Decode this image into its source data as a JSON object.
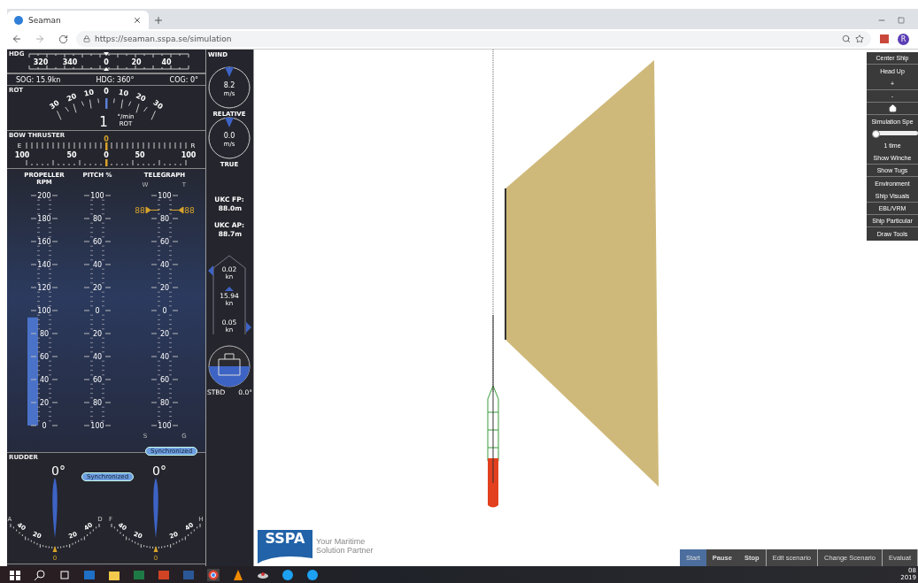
{
  "browser": {
    "tab_title": "Seaman",
    "url": "https://seaman.sspa.se/simulation",
    "avatar": "R"
  },
  "hdg": {
    "label": "HDG",
    "ticks": [
      "320",
      "340",
      "0",
      "20",
      "40"
    ],
    "readouts": [
      "SOG: 15.9kn",
      "HDG: 360°",
      "COG: 0°"
    ]
  },
  "rot": {
    "label": "ROT",
    "ticks": [
      "30",
      "20",
      "10",
      "0",
      "10",
      "20",
      "30"
    ],
    "value": "1",
    "unit": "°/min",
    "unit_caption": "ROT"
  },
  "bow_thruster": {
    "label": "BOW THRUSTER",
    "left": "E",
    "right": "R",
    "ticks": [
      "100",
      "50",
      "0",
      "50",
      "100"
    ],
    "pointer": "0"
  },
  "engine": {
    "columns": [
      {
        "kind": "propeller",
        "title": "PROPELLER",
        "subtitle": "RPM",
        "ticks": [
          "200",
          "180",
          "160",
          "140",
          "120",
          "100",
          "80",
          "60",
          "40",
          "20",
          "0"
        ],
        "level": 0.47
      },
      {
        "kind": "pitch",
        "title": "PITCH %",
        "ticks": [
          "100",
          "80",
          "60",
          "40",
          "20",
          "0",
          "20",
          "40",
          "60",
          "80",
          "100"
        ]
      },
      {
        "kind": "telegraph",
        "title": "TELEGRAPH",
        "top_left": "W",
        "top_right": "T",
        "bottom_left": "S",
        "bottom_right": "G",
        "ticks": [
          "100",
          "80",
          "60",
          "40",
          "20",
          "0",
          "20",
          "40",
          "60",
          "80",
          "100"
        ],
        "markers": [
          "88",
          "88"
        ]
      }
    ],
    "sync": "Synchronized"
  },
  "rudder": {
    "label": "RUDDER",
    "sync": "Synchronized",
    "gauges": [
      {
        "angle": "0°",
        "left": "A",
        "right": "D",
        "ticks": [
          "40",
          "20",
          "20",
          "40"
        ],
        "pointer": "0"
      },
      {
        "angle": "0°",
        "left": "F",
        "right": "H",
        "ticks": [
          "40",
          "20",
          "20",
          "40"
        ],
        "pointer": "0"
      }
    ]
  },
  "wind": {
    "label": "WIND",
    "dials": [
      {
        "value": "8.2",
        "unit": "m/s",
        "caption": "RELATIVE"
      },
      {
        "value": "0.0",
        "unit": "m/s",
        "caption": "TRUE"
      }
    ]
  },
  "ukc": [
    {
      "label": "UKC FP:",
      "value": "88.0m"
    },
    {
      "label": "UKC AP:",
      "value": "88.7m"
    }
  ],
  "speeds": [
    {
      "kind": "bow",
      "value": "0.02",
      "unit": "kn"
    },
    {
      "kind": "ahead",
      "value": "15.94",
      "unit": "kn"
    },
    {
      "kind": "stern",
      "value": "0.05",
      "unit": "kn"
    }
  ],
  "heel": {
    "side": "STBD",
    "value": "0.0°"
  },
  "map_menu": [
    {
      "kind": "button",
      "label": "Center Ship"
    },
    {
      "kind": "button",
      "label": "Head Up"
    },
    {
      "kind": "button",
      "label": "+"
    },
    {
      "kind": "button",
      "label": "-"
    },
    {
      "kind": "home"
    },
    {
      "kind": "text",
      "label": "Simulation Spe"
    },
    {
      "kind": "slider",
      "level": 0.03
    },
    {
      "kind": "text",
      "label": "1 time"
    },
    {
      "kind": "button",
      "label": "Show Winche"
    },
    {
      "kind": "button",
      "label": "Show Tugs"
    },
    {
      "kind": "button",
      "label": "Environment"
    },
    {
      "kind": "button",
      "label": "Ship Visuals"
    },
    {
      "kind": "button",
      "label": "EBL/VRM"
    },
    {
      "kind": "button",
      "label": "Ship Particular"
    },
    {
      "kind": "button",
      "label": "Draw Tools"
    }
  ],
  "logo": {
    "name": "SSPA",
    "tagline": "Your Maritime Solution Partner"
  },
  "controls": [
    {
      "label": "Start",
      "selected": true
    },
    {
      "label": "Pause",
      "selected": false
    },
    {
      "label": "Stop",
      "selected": false
    },
    {
      "label": "Edit scenario",
      "selected": false
    },
    {
      "label": "Change Scenario",
      "selected": false
    },
    {
      "label": "Evaluat",
      "selected": false
    }
  ],
  "taskbar": {
    "clock": [
      "08",
      "2019"
    ]
  }
}
